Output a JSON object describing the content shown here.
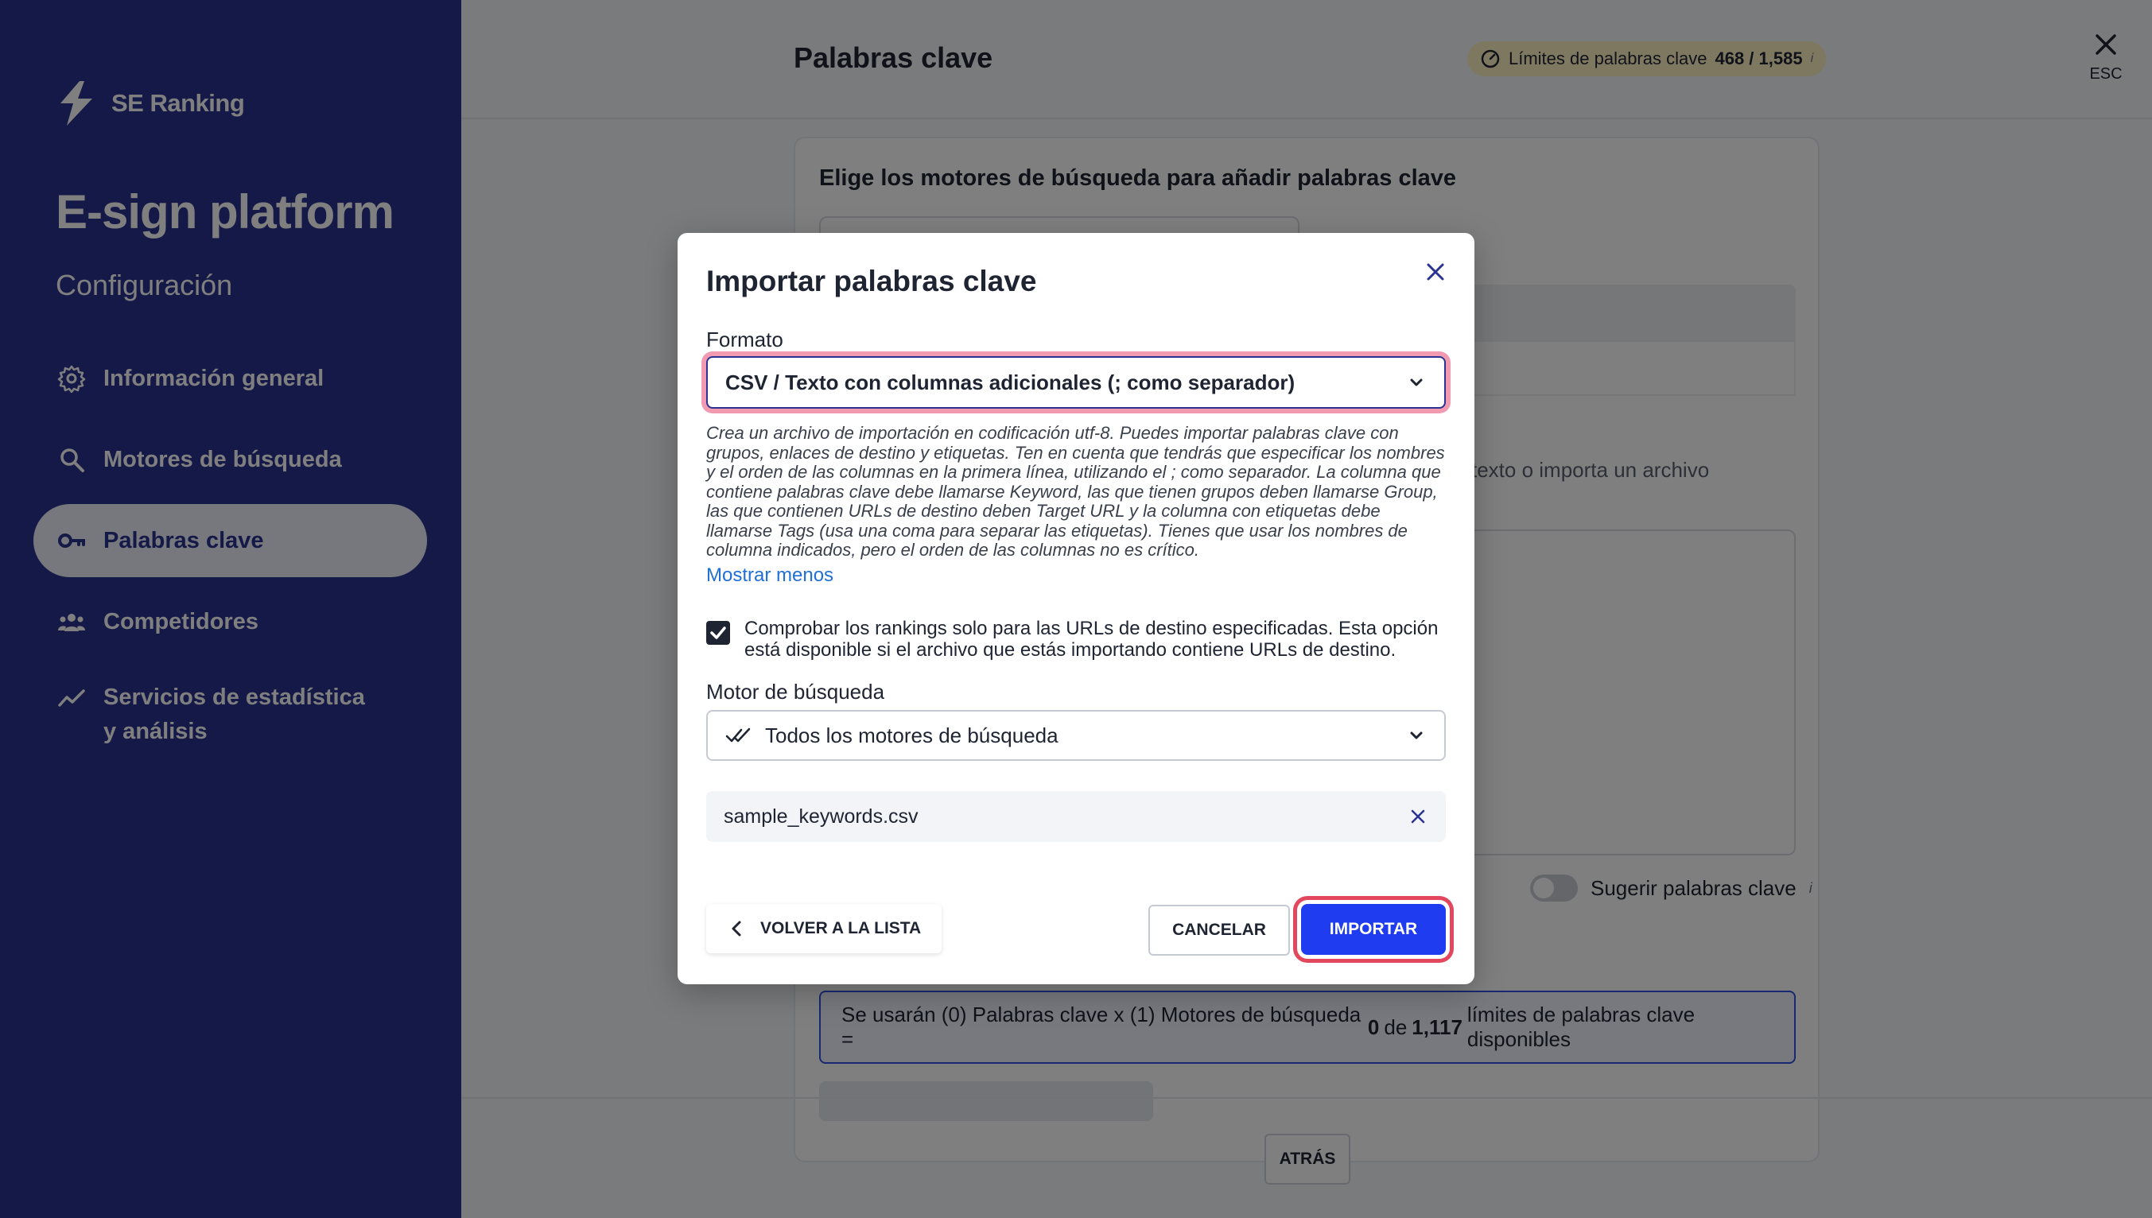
{
  "sidebar": {
    "brand": "SE Ranking",
    "project": "E-sign platform",
    "section": "Configuración",
    "items": [
      {
        "label": "Información general",
        "icon": "gear-icon"
      },
      {
        "label": "Motores de búsqueda",
        "icon": "search-icon"
      },
      {
        "label": "Palabras clave",
        "icon": "key-icon",
        "active": true
      },
      {
        "label": "Competidores",
        "icon": "users-icon"
      },
      {
        "label": "Servicios de estadística y análisis",
        "icon": "trend-icon"
      }
    ]
  },
  "header": {
    "title": "Palabras clave",
    "limits_label": "Límites de palabras clave",
    "limits_value": "468 / 1,585",
    "limits_info": "i",
    "esc_label": "ESC"
  },
  "page": {
    "card_title": "Elige los motores de búsqueda para añadir palabras clave",
    "hint_text": "texto o importa un archivo",
    "suggest_label": "Sugerir palabras clave",
    "suggest_info": "i",
    "summary_pre": "Se usarán (0) Palabras clave x (1) Motores de búsqueda =",
    "summary_zero": "0",
    "summary_mid": "de",
    "summary_total": "1,117",
    "summary_post": "límites de palabras clave disponibles",
    "back_label": "ATRÁS"
  },
  "modal": {
    "title": "Importar palabras clave",
    "format_label": "Formato",
    "format_value": "CSV / Texto con columnas adicionales (; como separador)",
    "description": "Crea un archivo de importación en codificación utf-8. Puedes importar palabras clave con grupos, enlaces de destino y etiquetas. Ten en cuenta que tendrás que especificar los nombres y el orden de las columnas en la primera línea, utilizando el ; como separador. La columna que contiene palabras clave debe llamarse Keyword, las que tienen grupos deben llamarse Group, las que contienen URLs de destino deben Target URL y la columna con etiquetas debe llamarse Tags (usa una coma para separar las etiquetas). Tienes que usar los nombres de columna indicados, pero el orden de las columnas no es crítico.",
    "show_less": "Mostrar menos",
    "checkbox_checked": true,
    "checkbox_text": "Comprobar los rankings solo para las URLs de destino especificadas. Esta opción está disponible si el archivo que estás importando contiene URLs de destino.",
    "engine_label": "Motor de búsqueda",
    "engine_value": "Todos los motores de búsqueda",
    "file_name": "sample_keywords.csv",
    "back_to_list": "VOLVER A LA LISTA",
    "cancel": "CANCELAR",
    "import": "IMPORTAR"
  },
  "colors": {
    "sidebar_bg": "#2a3391",
    "primary_button": "#1f3cf0",
    "focus_ring": "#e2475e",
    "link": "#1f6fd6",
    "limits_badge": "#fff0c2"
  }
}
